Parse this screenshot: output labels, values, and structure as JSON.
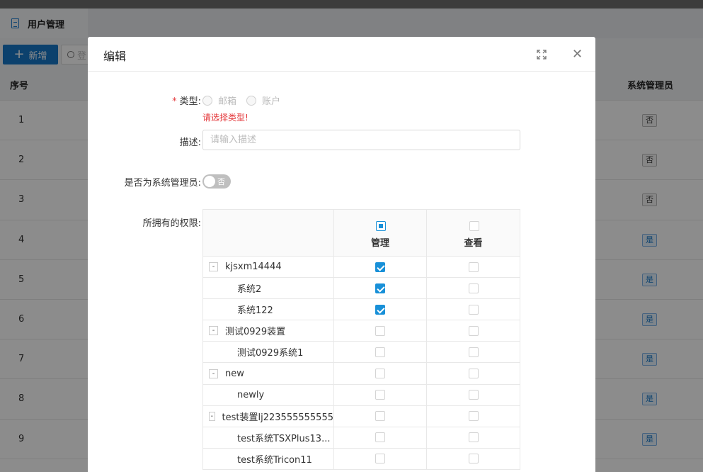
{
  "tab": {
    "label": "用户管理"
  },
  "toolbar": {
    "add_label": "新增",
    "search_placeholder": "登"
  },
  "bg_table": {
    "col_index": "序号",
    "col_admin": "系统管理员",
    "rows": [
      {
        "num": "1",
        "admin": "否"
      },
      {
        "num": "2",
        "admin": "否"
      },
      {
        "num": "3",
        "admin": "否"
      },
      {
        "num": "4",
        "admin": "是"
      },
      {
        "num": "5",
        "admin": "是"
      },
      {
        "num": "6",
        "admin": "是"
      },
      {
        "num": "7",
        "admin": "是"
      },
      {
        "num": "8",
        "admin": "是"
      },
      {
        "num": "9",
        "admin": "是"
      }
    ]
  },
  "modal": {
    "title": "编辑",
    "type_label": "类型:",
    "type_options": [
      "邮箱",
      "账户"
    ],
    "type_error": "请选择类型!",
    "desc_label": "描述:",
    "desc_placeholder": "请输入描述",
    "admin_label": "是否为系统管理员:",
    "admin_switch_text": "否",
    "perm_label": "所拥有的权限:",
    "perm_cols": [
      "管理",
      "查看"
    ],
    "perm_rows": [
      {
        "name": "kjsxm14444",
        "parent": true,
        "toggle": "-",
        "manage": true,
        "view": false
      },
      {
        "name": "系统2",
        "parent": false,
        "manage": true,
        "view": false
      },
      {
        "name": "系统122",
        "parent": false,
        "manage": true,
        "view": false
      },
      {
        "name": "测试0929装置",
        "parent": true,
        "toggle": "-",
        "manage": false,
        "view": false
      },
      {
        "name": "测试0929系统1",
        "parent": false,
        "manage": false,
        "view": false
      },
      {
        "name": "new",
        "parent": true,
        "toggle": "-",
        "manage": false,
        "view": false
      },
      {
        "name": "newly",
        "parent": false,
        "manage": false,
        "view": false
      },
      {
        "name": "test装置lj223555555555",
        "parent": true,
        "toggle": "-",
        "manage": false,
        "view": false
      },
      {
        "name": "test系统TSXPlus13...",
        "parent": false,
        "manage": false,
        "view": false
      },
      {
        "name": "test系统Tricon11",
        "parent": false,
        "manage": false,
        "view": false
      }
    ]
  }
}
